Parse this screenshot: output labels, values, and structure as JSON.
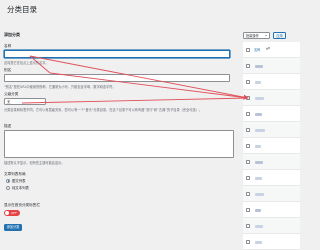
{
  "page": {
    "title": "分类目录"
  },
  "form": {
    "section_title": "添加分类",
    "name": {
      "label": "名称",
      "value": "",
      "description": "这将是它在站点上显示的名字。"
    },
    "slug": {
      "label": "别名",
      "value": "",
      "description": "“别名”是在URL中使用的别称，它通常为小写，只能包含字母，数字和连字符。"
    },
    "parent": {
      "label": "父级分类",
      "selected": "无",
      "description": "分类目录和标签不同，它可以有层级关系。您可以有一个“音乐”分类目录，在这个目录下可以有叫做“流行”和“古典”的子目录（完全可选）。"
    },
    "description": {
      "label": "描述",
      "value": "",
      "description": "描述默认不显示，但有些主题可能会显示。"
    },
    "display": {
      "label": "文章列表布局",
      "options": [
        {
          "label": "图文列表",
          "checked": true
        },
        {
          "label": "纯文本列表",
          "checked": false
        }
      ]
    },
    "toggle": {
      "label": "显示在首页分类标签栏",
      "state_text": "OFF",
      "on": false
    },
    "submit_label": "添加分类"
  },
  "list": {
    "bulk_action": "批量操作",
    "apply_label": "应用",
    "header_name": "名称",
    "sort_indicator": "▲▼",
    "rows": [
      1,
      2,
      3,
      4,
      5,
      6,
      7,
      8,
      9,
      10,
      11,
      12
    ]
  },
  "colors": {
    "accent": "#2271b1",
    "arrow": "#e0525a",
    "toggle_off": "#e54545"
  }
}
